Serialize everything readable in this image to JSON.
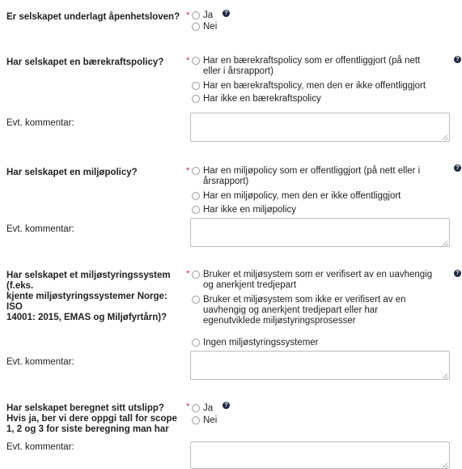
{
  "q1": {
    "question": "Er selskapet underlagt åpenhetsloven?",
    "required_mark": "*",
    "options": [
      "Ja",
      "Nei"
    ],
    "help_icon": "question-circle-icon"
  },
  "q2": {
    "question": "Har selskapet en bærekraftspolicy?",
    "required_mark": "*",
    "options": [
      "Har en bærekraftspolicy som er offentliggjort (på nett",
      "eller i årsrapport)",
      "Har en bærekraftspolicy, men den er ikke offentliggjort",
      "Har ikke en bærekraftspolicy"
    ],
    "comment_label": "Evt. kommentar:",
    "help_icon": "question-circle-icon"
  },
  "q3": {
    "question": "Har selskapet en miljøpolicy?",
    "required_mark": "*",
    "options": [
      "Har en miljøpolicy som er offentliggjort (på nett eller i",
      "årsrapport)",
      "Har en miljøpolicy, men den er ikke offentliggjort",
      "Har ikke en miljøpolicy"
    ],
    "comment_label": "Evt. kommentar:",
    "help_icon": "question-circle-icon"
  },
  "q4": {
    "question_lines": [
      "Har selskapet et miljøstyringssystem",
      "(f.eks.",
      "kjente miljøstyringssystemer Norge:",
      "ISO",
      "14001: 2015, EMAS og Miljøfyrtårn)?"
    ],
    "required_mark": "*",
    "options": [
      "Bruker et miljøsystem som er verifisert av en uavhengig",
      "og anerkjent tredjepart",
      "Bruker et miljøsystem som ikke er verifisert av en",
      "uavhengig og anerkjent tredjepart eller har",
      "egenutviklede miljøstyringsprosesser",
      "Ingen miljøstyringssystemer"
    ],
    "comment_label": "Evt. kommentar:",
    "help_icon": "question-circle-icon"
  },
  "q5": {
    "question_lines": [
      "Har selskapet beregnet sitt utslipp?",
      "Hvis ja, ber vi dere oppgi tall for scope",
      "1, 2 og 3 for siste beregning man har"
    ],
    "required_mark": "*",
    "options": [
      "Ja",
      "Nei"
    ],
    "comment_label": "Evt. kommentar:",
    "help_icon": "question-circle-icon"
  },
  "help_glyph": "?"
}
